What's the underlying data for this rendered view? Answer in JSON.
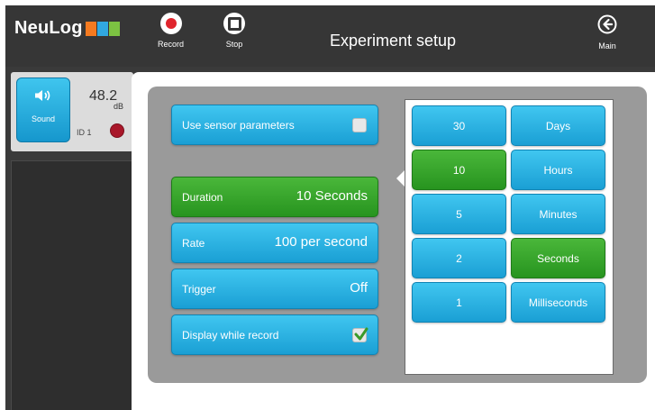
{
  "app": {
    "logo_text": "NeuLog",
    "title": "Experiment setup"
  },
  "toolbar": {
    "record_label": "Record",
    "stop_label": "Stop",
    "main_label": "Main"
  },
  "sensor": {
    "name": "Sound",
    "value": "48.2",
    "unit": "dB",
    "id": "ID 1",
    "led_color": "#a9172a"
  },
  "settings": {
    "use_sensor_params": {
      "label": "Use sensor parameters",
      "checked": false
    },
    "duration": {
      "label": "Duration",
      "value": "10 Seconds",
      "selected": true
    },
    "rate": {
      "label": "Rate",
      "value": "100 per second"
    },
    "trigger": {
      "label": "Trigger",
      "value": "Off"
    },
    "display_while_record": {
      "label": "Display while record",
      "checked": true
    }
  },
  "duration_values": [
    {
      "label": "30",
      "selected": false
    },
    {
      "label": "10",
      "selected": true
    },
    {
      "label": "5",
      "selected": false
    },
    {
      "label": "2",
      "selected": false
    },
    {
      "label": "1",
      "selected": false
    }
  ],
  "duration_units": [
    {
      "label": "Days",
      "selected": false
    },
    {
      "label": "Hours",
      "selected": false
    },
    {
      "label": "Minutes",
      "selected": false
    },
    {
      "label": "Seconds",
      "selected": true
    },
    {
      "label": "Milliseconds",
      "selected": false
    }
  ],
  "colors": {
    "accent_blue": "#1a9fd4",
    "selected_green": "#27941f",
    "record_red": "#e0252d"
  }
}
